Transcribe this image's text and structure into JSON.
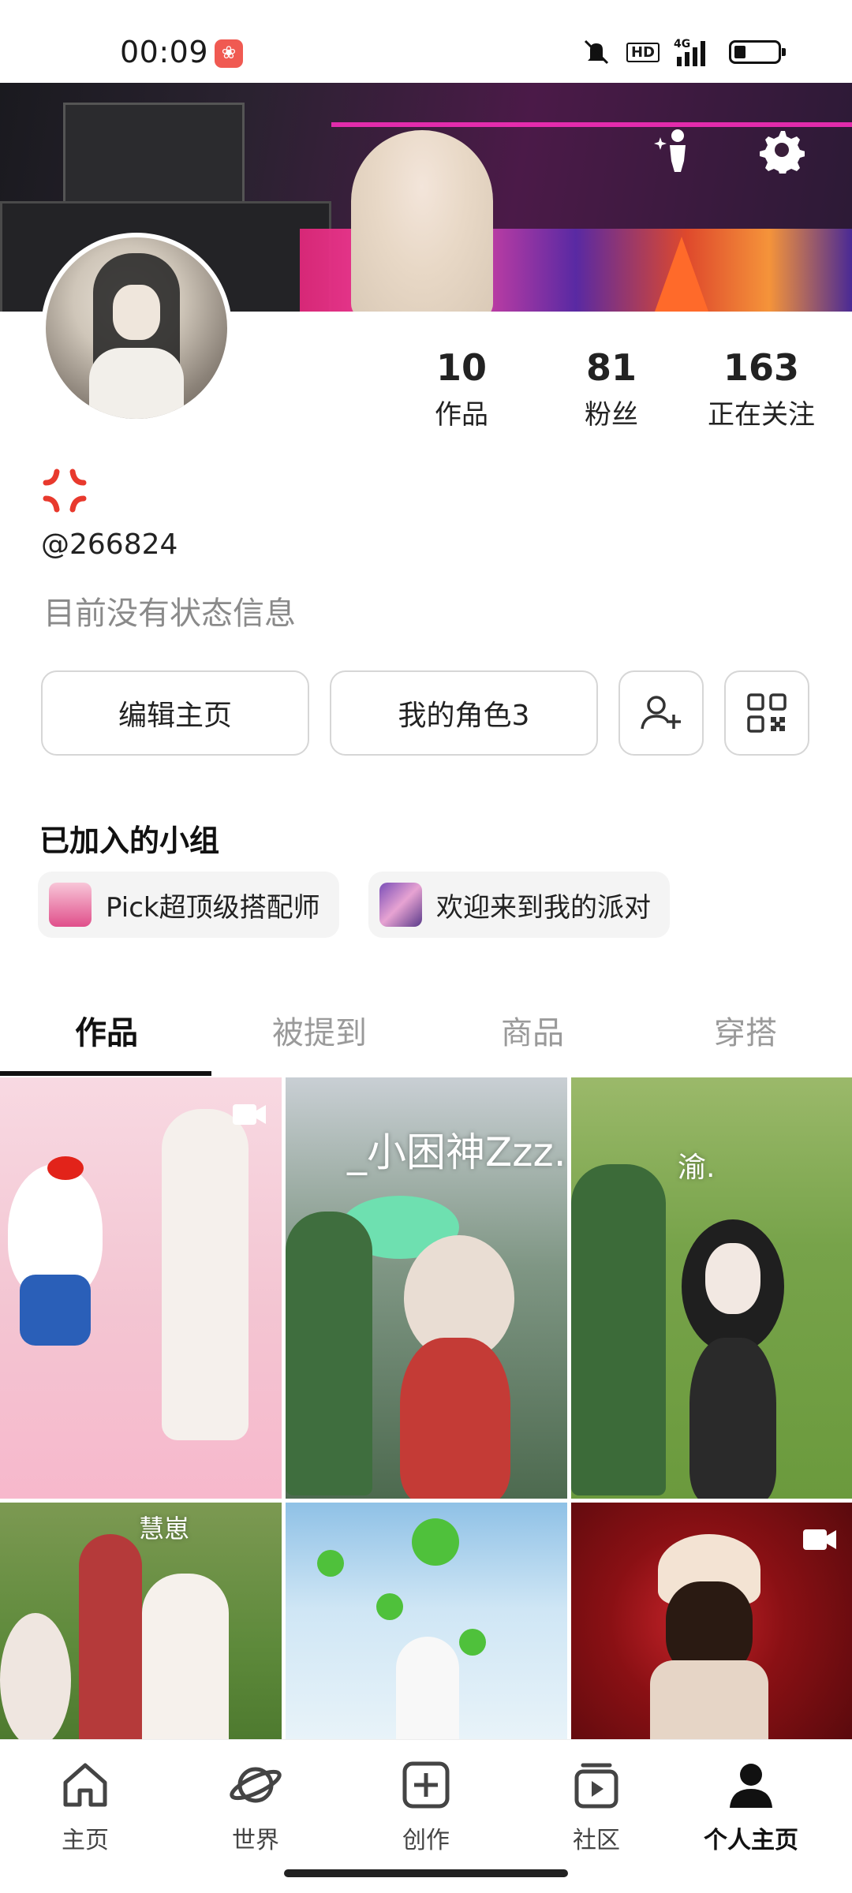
{
  "status_bar": {
    "time": "00:09",
    "network": "4G",
    "hd": "HD"
  },
  "profile": {
    "username_icon": "anger-symbol-icon",
    "handle": "@266824",
    "status_message": "目前没有状态信息",
    "stats": [
      {
        "value": "10",
        "label": "作品"
      },
      {
        "value": "81",
        "label": "粉丝"
      },
      {
        "value": "163",
        "label": "正在关注"
      }
    ]
  },
  "actions": {
    "edit_label": "编辑主页",
    "role_label": "我的角色3"
  },
  "groups": {
    "title": "已加入的小组",
    "items": [
      {
        "label": "Pick超顶级搭配师"
      },
      {
        "label": "欢迎来到我的派对"
      }
    ]
  },
  "tabs": [
    {
      "label": "作品",
      "active": true
    },
    {
      "label": "被提到",
      "active": false
    },
    {
      "label": "商品",
      "active": false
    },
    {
      "label": "穿搭",
      "active": false
    }
  ],
  "grid": {
    "tile2_text": "_小困神Zzz.",
    "tile3_text": "渝.",
    "tile4_text": "慧崽"
  },
  "bottom_nav": [
    {
      "label": "主页",
      "icon": "home-icon",
      "active": false
    },
    {
      "label": "世界",
      "icon": "planet-icon",
      "active": false
    },
    {
      "label": "创作",
      "icon": "create-icon",
      "active": false
    },
    {
      "label": "社区",
      "icon": "community-icon",
      "active": false
    },
    {
      "label": "个人主页",
      "icon": "profile-icon",
      "active": true
    }
  ],
  "colors": {
    "accent": "#111111",
    "muted_text": "#8a8a8a",
    "chip_bg": "#f4f4f4",
    "anger_icon": "#e8392d"
  }
}
